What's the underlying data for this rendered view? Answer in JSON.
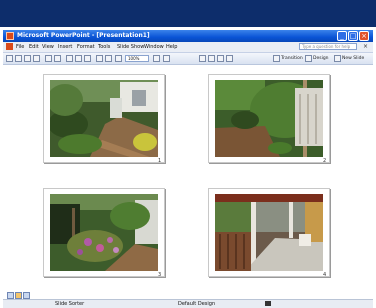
{
  "window": {
    "title": "Microsoft PowerPoint - [Presentation1]"
  },
  "menu": {
    "items": [
      "File",
      "Edit",
      "View",
      "Insert",
      "Format",
      "Tools",
      "Slide Show",
      "Window",
      "Help"
    ],
    "ask_placeholder": "Type a question for help"
  },
  "toolbar": {
    "zoom": "100%",
    "transition_label": "Transition",
    "design_label": "Design",
    "new_slide_label": "New Slide"
  },
  "slides": [
    {
      "number": "1",
      "description_icon": "garden-path-photo"
    },
    {
      "number": "2",
      "description_icon": "garden-gate-photo"
    },
    {
      "number": "3",
      "description_icon": "flower-bed-photo"
    },
    {
      "number": "4",
      "description_icon": "porch-photo"
    }
  ],
  "status": {
    "view": "Slide Sorter",
    "design": "Default Design"
  }
}
